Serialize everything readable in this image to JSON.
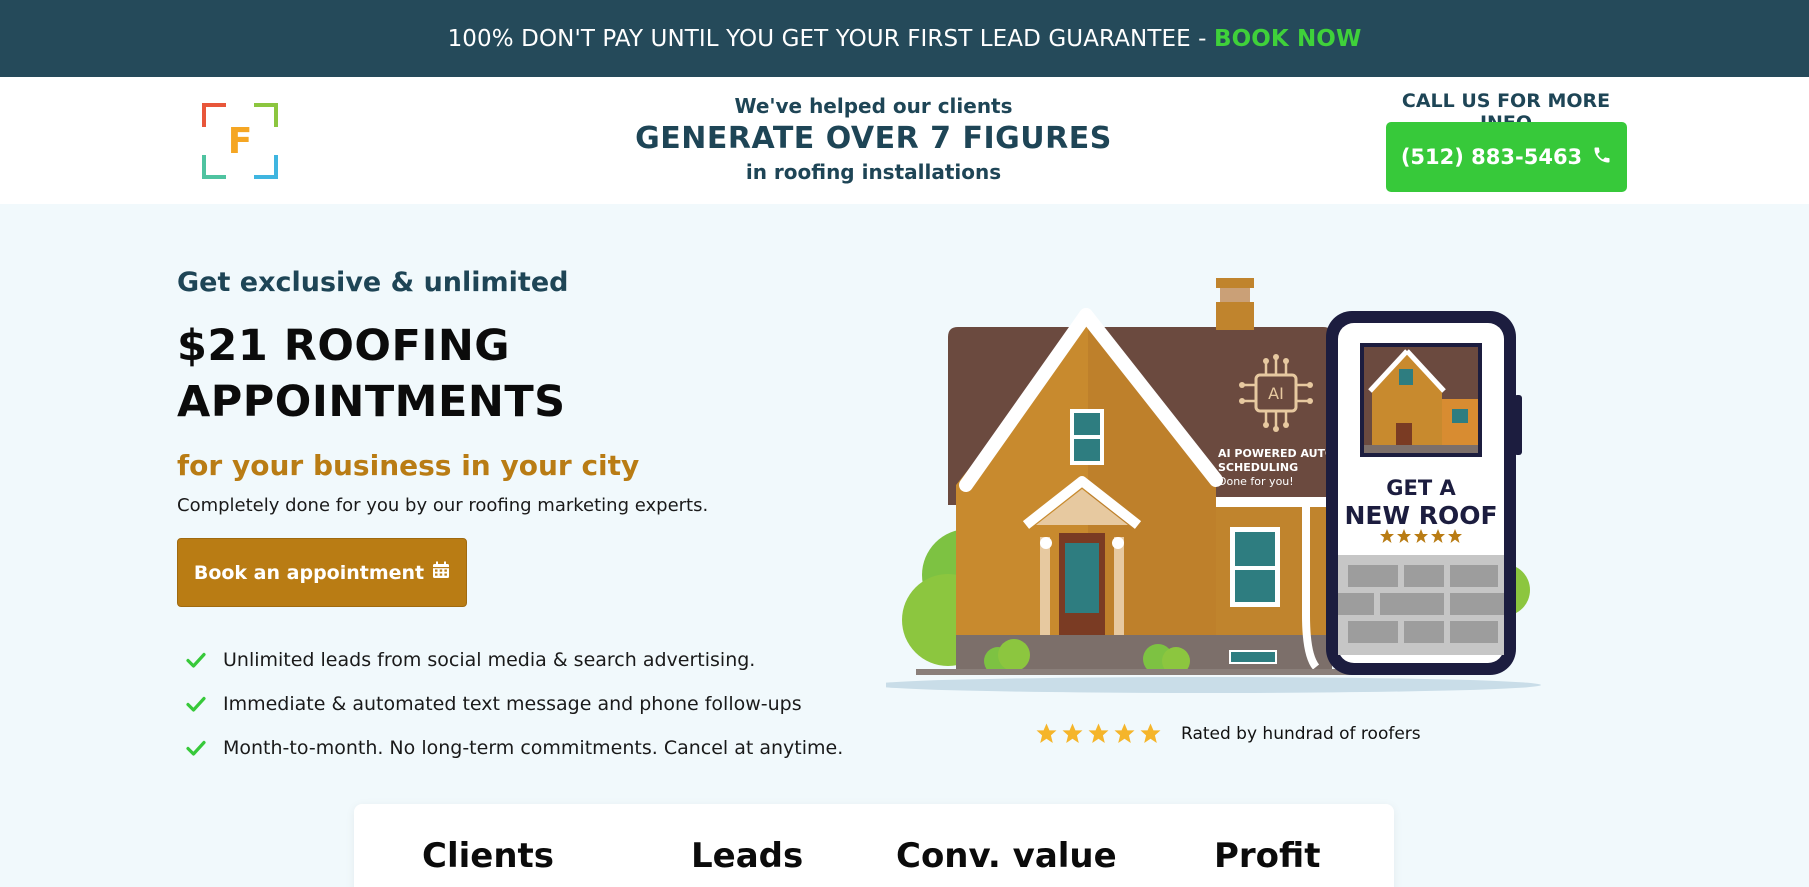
{
  "promo": {
    "text": "100% DON'T PAY UNTIL YOU GET YOUR FIRST LEAD GUARANTEE - ",
    "cta": "BOOK NOW",
    "cta_color": "#3fd13a",
    "background": "#254a5a"
  },
  "header": {
    "logo_letter": "F",
    "line1": "We've helped our clients",
    "line2": "GENERATE OVER 7 FIGURES",
    "line3": "in roofing installations",
    "call_label": "CALL US FOR MORE INFO",
    "phone": "(512) 883-5463",
    "phone_icon": "phone-icon",
    "call_color": "#37c93a"
  },
  "hero": {
    "eyebrow": "Get exclusive & unlimited",
    "headline": "$21 ROOFING APPOINTMENTS",
    "subhead": "for your business in your city",
    "description": "Completely done for you by our roofing marketing experts.",
    "book_button": "Book an appointment",
    "book_icon": "calendar-icon",
    "accent_color": "#b97c14",
    "benefits": [
      "Unlimited leads from social media & search advertising.",
      "Immediate & automated text message and phone follow-ups",
      "Month-to-month. No long-term commitments. Cancel at anytime."
    ]
  },
  "illustration": {
    "chip_label": "AI",
    "ai_line1": "AI POWERED AUTO",
    "ai_line2": "SCHEDULING",
    "ai_line3": "Done for you!",
    "phone_line1": "GET A",
    "phone_line2": "NEW ROOF",
    "phone_stars": 5
  },
  "rating": {
    "stars": 5,
    "text": "Rated by hundrad of roofers",
    "star_color": "#f5b52a"
  },
  "stats": {
    "labels": [
      "Clients",
      "Leads",
      "Conv. value",
      "Profit"
    ]
  }
}
